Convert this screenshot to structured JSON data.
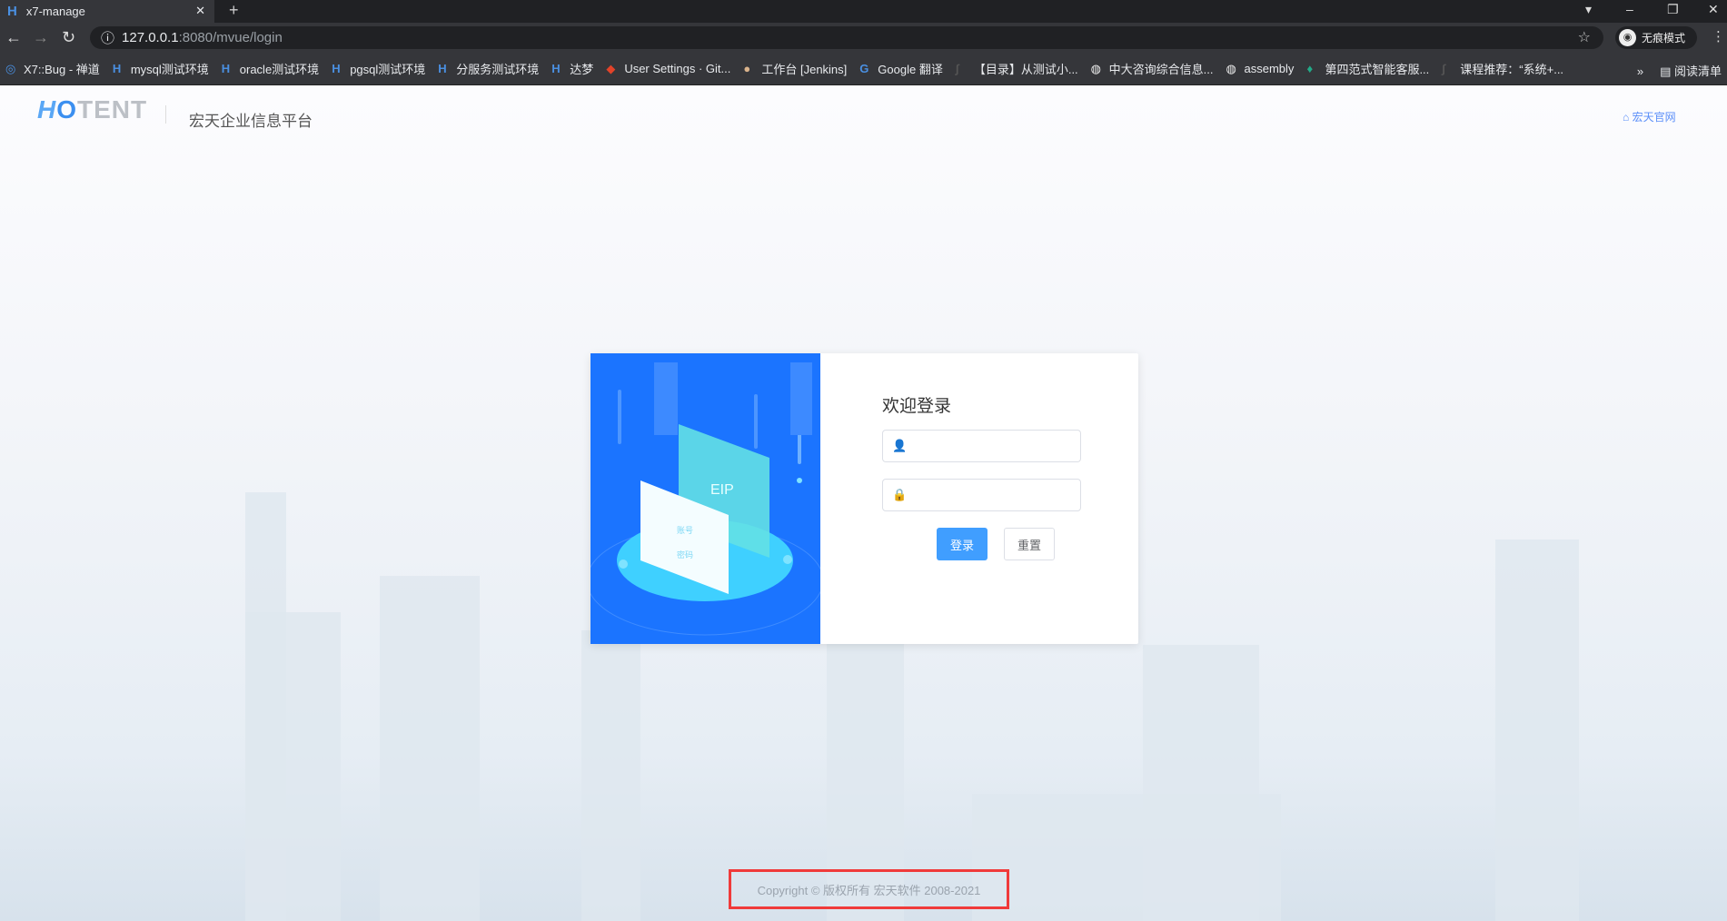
{
  "browser": {
    "tab_title": "x7-manage",
    "url_host": "127.0.0.1",
    "url_path": ":8080/mvue/login",
    "incognito_label": "无痕模式",
    "bookmarks": [
      "X7::Bug - 禅道",
      "mysql测试环境",
      "oracle测试环境",
      "pgsql测试环境",
      "分服务测试环境",
      "达梦",
      "User Settings · Git...",
      "工作台 [Jenkins]",
      "Google 翻译",
      "【目录】从测试小...",
      "中大咨询综合信息...",
      "assembly",
      "第四范式智能客服...",
      "课程推荐：“系统+..."
    ],
    "reading_list": "阅读清单"
  },
  "header": {
    "logo": "HOTENT",
    "title": "宏天企业信息平台",
    "home_link": "宏天官网"
  },
  "login": {
    "title": "欢迎登录",
    "username_value": "",
    "password_value": "",
    "login_button": "登录",
    "reset_button": "重置",
    "illus_field1": "账号",
    "illus_field2": "密码",
    "illus_badge": "EIP"
  },
  "footer": {
    "copyright": "Copyright © 版权所有 宏天软件 2008-2021"
  }
}
